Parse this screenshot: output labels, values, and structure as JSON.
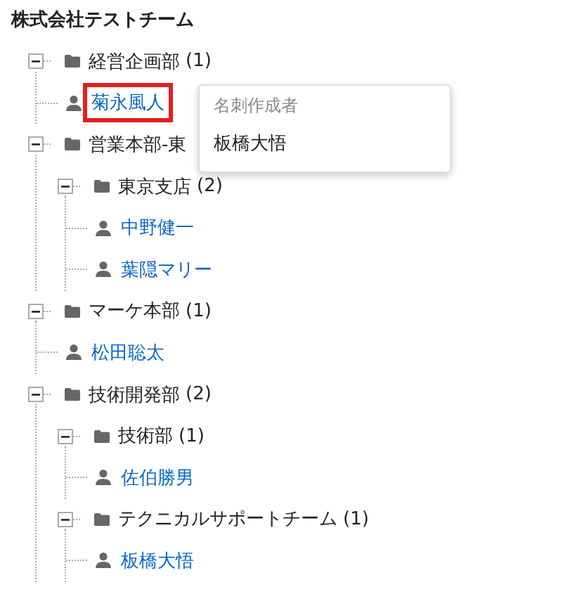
{
  "title": "株式会社テストチーム",
  "tree": [
    {
      "kind": "folder",
      "label": "経営企画部",
      "count": "(1)",
      "expanded": true,
      "children": [
        {
          "kind": "person",
          "label": "菊永風人",
          "highlighted": true
        }
      ]
    },
    {
      "kind": "folder",
      "label": "営業本部-東",
      "expanded": true,
      "children": [
        {
          "kind": "folder",
          "label": "東京支店",
          "count": "(2)",
          "expanded": true,
          "children": [
            {
              "kind": "person",
              "label": "中野健一",
              "highlighted": false
            },
            {
              "kind": "person",
              "label": "葉隠マリー",
              "highlighted": false
            }
          ]
        }
      ]
    },
    {
      "kind": "folder",
      "label": "マーケ本部",
      "count": "(1)",
      "expanded": true,
      "children": [
        {
          "kind": "person",
          "label": "松田聡太",
          "highlighted": false
        }
      ]
    },
    {
      "kind": "folder",
      "label": "技術開発部",
      "count": "(2)",
      "expanded": true,
      "children": [
        {
          "kind": "folder",
          "label": "技術部",
          "count": "(1)",
          "expanded": true,
          "children": [
            {
              "kind": "person",
              "label": "佐伯勝男",
              "highlighted": false
            }
          ]
        },
        {
          "kind": "folder",
          "label": "テクニカルサポートチーム",
          "count": "(1)",
          "expanded": true,
          "children": [
            {
              "kind": "person",
              "label": "板橋大悟",
              "highlighted": false
            }
          ]
        }
      ]
    }
  ],
  "tooltip": {
    "label": "名刺作成者",
    "value": "板橋大悟"
  }
}
